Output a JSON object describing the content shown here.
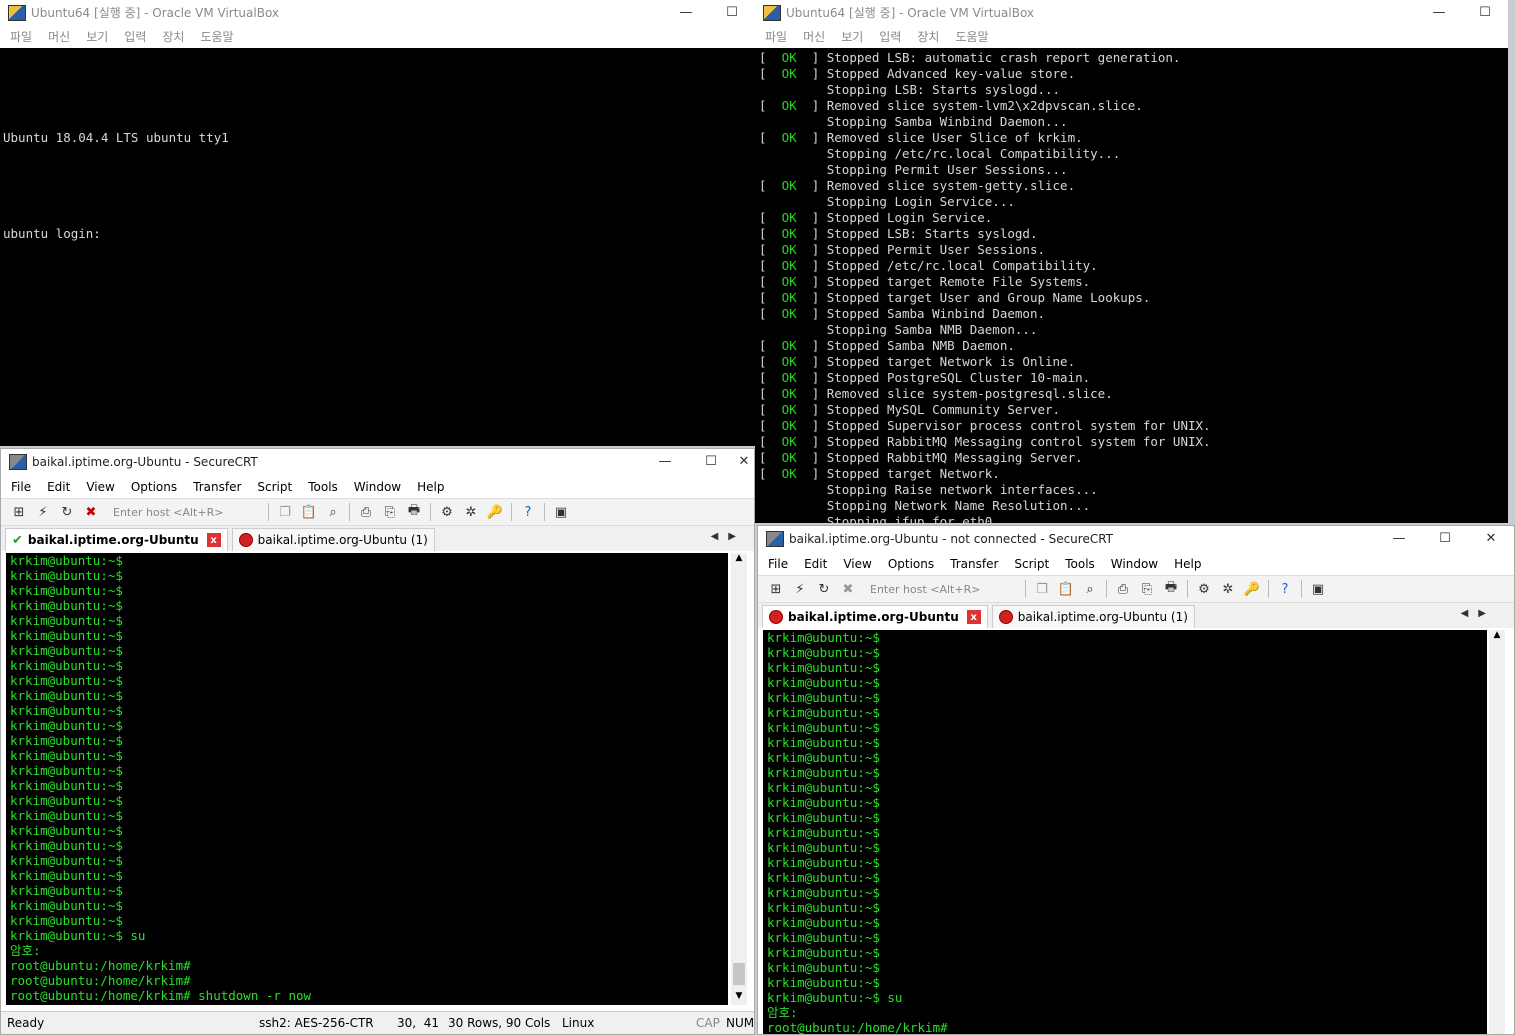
{
  "vb_left": {
    "title": "Ubuntu64 [실행 중] - Oracle VM VirtualBox",
    "menu": [
      "파일",
      "머신",
      "보기",
      "입력",
      "장치",
      "도움말"
    ],
    "screen_lines": [
      "",
      "Ubuntu 18.04.4 LTS ubuntu tty1",
      "",
      "ubuntu login:"
    ]
  },
  "vb_right": {
    "title": "Ubuntu64 [실행 중] - Oracle VM VirtualBox",
    "menu": [
      "파일",
      "머신",
      "보기",
      "입력",
      "장치",
      "도움말"
    ],
    "boot": [
      {
        "ok": true,
        "text": "Stopped LSB: automatic crash report generation."
      },
      {
        "ok": true,
        "text": "Stopped Advanced key-value store."
      },
      {
        "ok": false,
        "text": "Stopping LSB: Starts syslogd..."
      },
      {
        "ok": true,
        "text": "Removed slice system-lvm2\\x2dpvscan.slice."
      },
      {
        "ok": false,
        "text": "Stopping Samba Winbind Daemon..."
      },
      {
        "ok": true,
        "text": "Removed slice User Slice of krkim."
      },
      {
        "ok": false,
        "text": "Stopping /etc/rc.local Compatibility..."
      },
      {
        "ok": false,
        "text": "Stopping Permit User Sessions..."
      },
      {
        "ok": true,
        "text": "Removed slice system-getty.slice."
      },
      {
        "ok": false,
        "text": "Stopping Login Service..."
      },
      {
        "ok": true,
        "text": "Stopped Login Service."
      },
      {
        "ok": true,
        "text": "Stopped LSB: Starts syslogd."
      },
      {
        "ok": true,
        "text": "Stopped Permit User Sessions."
      },
      {
        "ok": true,
        "text": "Stopped /etc/rc.local Compatibility."
      },
      {
        "ok": true,
        "text": "Stopped target Remote File Systems."
      },
      {
        "ok": true,
        "text": "Stopped target User and Group Name Lookups."
      },
      {
        "ok": true,
        "text": "Stopped Samba Winbind Daemon."
      },
      {
        "ok": false,
        "text": "Stopping Samba NMB Daemon..."
      },
      {
        "ok": true,
        "text": "Stopped Samba NMB Daemon."
      },
      {
        "ok": true,
        "text": "Stopped target Network is Online."
      },
      {
        "ok": true,
        "text": "Stopped PostgreSQL Cluster 10-main."
      },
      {
        "ok": true,
        "text": "Removed slice system-postgresql.slice."
      },
      {
        "ok": true,
        "text": "Stopped MySQL Community Server."
      },
      {
        "ok": true,
        "text": "Stopped Supervisor process control system for UNIX."
      },
      {
        "ok": true,
        "text": "Stopped RabbitMQ Messaging control system for UNIX."
      },
      {
        "ok": true,
        "text": "Stopped RabbitMQ Messaging Server."
      },
      {
        "ok": true,
        "text": "Stopped target Network."
      },
      {
        "ok": false,
        "text": "Stopping Raise network interfaces..."
      },
      {
        "ok": false,
        "text": "Stopping Network Name Resolution..."
      },
      {
        "ok": false,
        "text": "Stopping ifup for eth0..."
      }
    ]
  },
  "scrt_left": {
    "title": "baikal.iptime.org-Ubuntu - SecureCRT",
    "menu": [
      "File",
      "Edit",
      "View",
      "Options",
      "Transfer",
      "Script",
      "Tools",
      "Window",
      "Help"
    ],
    "host_placeholder": "Enter host <Alt+R>",
    "tab1": "baikal.iptime.org-Ubuntu",
    "tab1_close": "x",
    "tab2": "baikal.iptime.org-Ubuntu (1)",
    "lines": [
      "krkim@ubuntu:~$",
      "krkim@ubuntu:~$",
      "krkim@ubuntu:~$",
      "krkim@ubuntu:~$",
      "krkim@ubuntu:~$",
      "krkim@ubuntu:~$",
      "krkim@ubuntu:~$",
      "krkim@ubuntu:~$",
      "krkim@ubuntu:~$",
      "krkim@ubuntu:~$",
      "krkim@ubuntu:~$",
      "krkim@ubuntu:~$",
      "krkim@ubuntu:~$",
      "krkim@ubuntu:~$",
      "krkim@ubuntu:~$",
      "krkim@ubuntu:~$",
      "krkim@ubuntu:~$",
      "krkim@ubuntu:~$",
      "krkim@ubuntu:~$",
      "krkim@ubuntu:~$",
      "krkim@ubuntu:~$",
      "krkim@ubuntu:~$",
      "krkim@ubuntu:~$",
      "krkim@ubuntu:~$",
      "krkim@ubuntu:~$",
      "krkim@ubuntu:~$ su",
      "암호:",
      "root@ubuntu:/home/krkim#",
      "root@ubuntu:/home/krkim#",
      "root@ubuntu:/home/krkim# shutdown -r now"
    ],
    "status": {
      "ready": "Ready",
      "cipher": "ssh2: AES-256-CTR",
      "pos": "30,  41",
      "size": "30 Rows, 90 Cols",
      "os": "Linux",
      "cap": "CAP",
      "num": "NUM"
    }
  },
  "scrt_right": {
    "title": "baikal.iptime.org-Ubuntu - not connected - SecureCRT",
    "menu": [
      "File",
      "Edit",
      "View",
      "Options",
      "Transfer",
      "Script",
      "Tools",
      "Window",
      "Help"
    ],
    "host_placeholder": "Enter host <Alt+R>",
    "tab1": "baikal.iptime.org-Ubuntu",
    "tab1_close": "x",
    "tab2": "baikal.iptime.org-Ubuntu (1)",
    "lines": [
      "krkim@ubuntu:~$",
      "krkim@ubuntu:~$",
      "krkim@ubuntu:~$",
      "krkim@ubuntu:~$",
      "krkim@ubuntu:~$",
      "krkim@ubuntu:~$",
      "krkim@ubuntu:~$",
      "krkim@ubuntu:~$",
      "krkim@ubuntu:~$",
      "krkim@ubuntu:~$",
      "krkim@ubuntu:~$",
      "krkim@ubuntu:~$",
      "krkim@ubuntu:~$",
      "krkim@ubuntu:~$",
      "krkim@ubuntu:~$",
      "krkim@ubuntu:~$",
      "krkim@ubuntu:~$",
      "krkim@ubuntu:~$",
      "krkim@ubuntu:~$",
      "krkim@ubuntu:~$",
      "krkim@ubuntu:~$",
      "krkim@ubuntu:~$",
      "krkim@ubuntu:~$",
      "krkim@ubuntu:~$",
      "krkim@ubuntu:~$ su",
      "암호:",
      "root@ubuntu:/home/krkim#"
    ]
  },
  "colors": {
    "terminal_green": "#28e028",
    "boot_ok": "#2ad82a",
    "tab_error": "#d02020"
  }
}
